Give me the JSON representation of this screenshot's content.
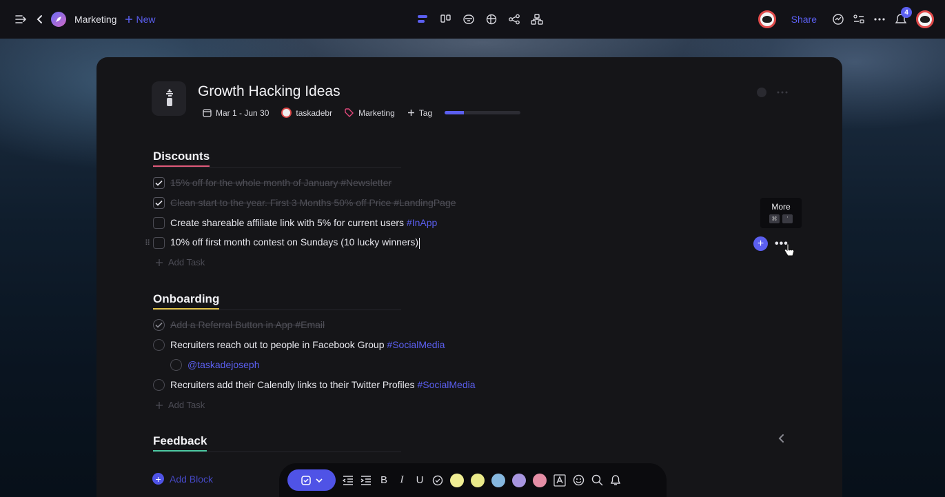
{
  "topbar": {
    "workspace_name": "Marketing",
    "new_label": "New",
    "share_label": "Share",
    "notification_count": "4"
  },
  "doc": {
    "title": "Growth Hacking Ideas",
    "date_range": "Mar 1 - Jun 30",
    "owner": "taskadebr",
    "folder": "Marketing",
    "add_tag_label": "Tag",
    "progress": 0.25
  },
  "sections": [
    {
      "title": "Discounts",
      "underline_color": "#e05a7a",
      "add_task_label": "Add Task",
      "tasks": [
        {
          "text": "15% off for the whole month of January #Newsletter",
          "tag": "",
          "done": true
        },
        {
          "text": "Clean start to the year. First 3 Months 50% off Price #LandingPage",
          "tag": "",
          "done": true
        },
        {
          "text": "Create shareable affiliate link with 5%  for current users ",
          "tag": "#InApp",
          "done": false
        },
        {
          "text": "10% off first month contest on Sundays (10 lucky winners)",
          "tag": "",
          "done": false
        }
      ]
    },
    {
      "title": "Onboarding",
      "underline_color": "#e0c24a",
      "add_task_label": "Add Task",
      "tasks": [
        {
          "text": "Add a Referral Button in App #Email",
          "tag": "",
          "done": true
        },
        {
          "text": "Recruiters reach out to people in Facebook Group ",
          "tag": "#SocialMedia",
          "done": false
        },
        {
          "text": "",
          "mention": "@taskadejoseph",
          "done": false
        },
        {
          "text": "Recruiters add their Calendly links to their Twitter Profiles ",
          "tag": "#SocialMedia",
          "done": false
        }
      ]
    },
    {
      "title": "Feedback",
      "underline_color": "#4ac7a0"
    }
  ],
  "tooltip": {
    "label": "More",
    "keys": [
      "⌘",
      "'"
    ]
  },
  "add_block_label": "Add Block",
  "toolbar": {
    "swatches": [
      "#f0ee94",
      "#eaea8a",
      "#86b8e0",
      "#a896e0",
      "#e58ea6"
    ]
  },
  "colors": {
    "accent": "#5b5ff0",
    "panel": "#151518",
    "topbar": "#121217"
  }
}
